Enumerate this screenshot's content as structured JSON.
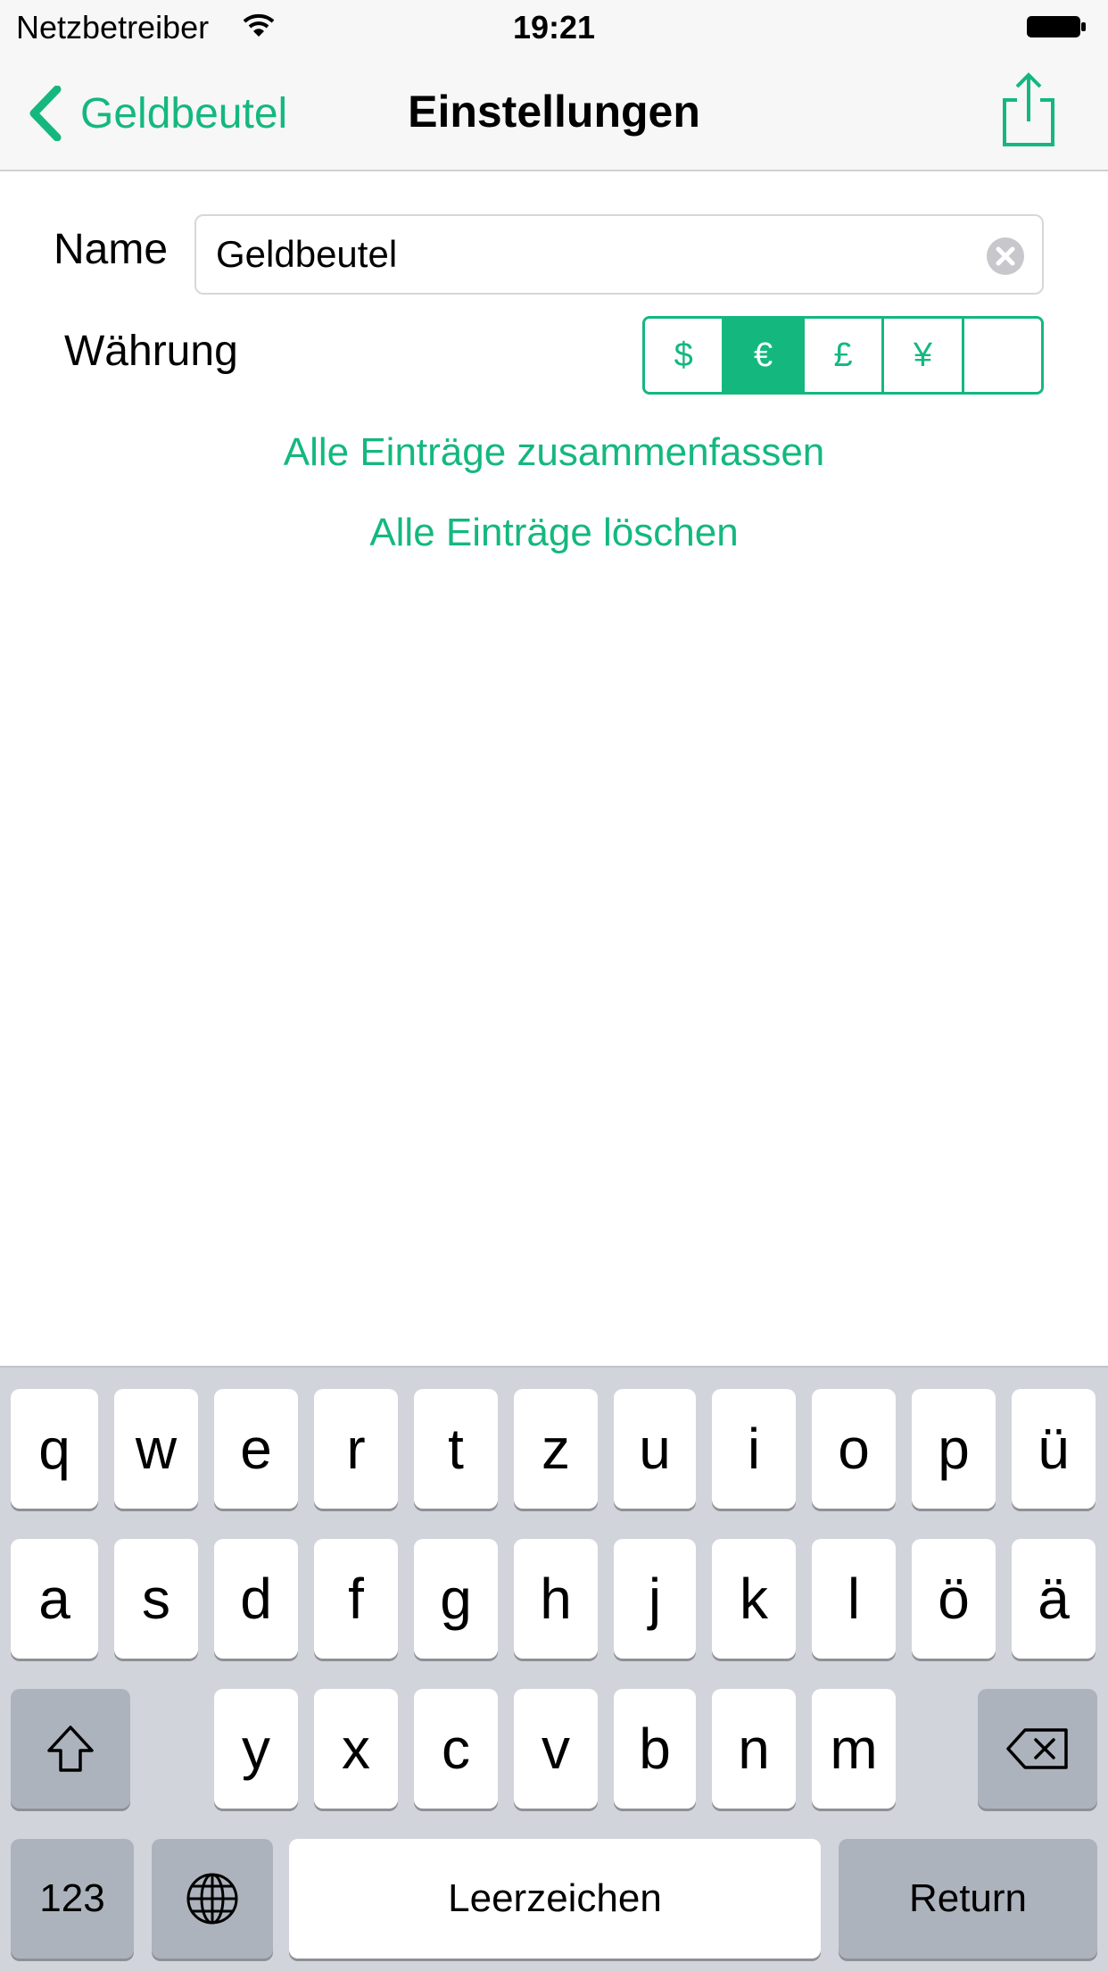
{
  "status_bar": {
    "carrier": "Netzbetreiber",
    "time": "19:21"
  },
  "nav": {
    "back_label": "Geldbeutel",
    "title": "Einstellungen"
  },
  "form": {
    "name_label": "Name",
    "name_value": "Geldbeutel",
    "currency_label": "Währung",
    "currency_options": [
      "$",
      "€",
      "£",
      "¥",
      ""
    ],
    "currency_selected": "€"
  },
  "actions": {
    "merge_all": "Alle Einträge zusammenfassen",
    "delete_all": "Alle Einträge löschen"
  },
  "keyboard": {
    "row1": [
      "q",
      "w",
      "e",
      "r",
      "t",
      "z",
      "u",
      "i",
      "o",
      "p",
      "ü"
    ],
    "row2": [
      "a",
      "s",
      "d",
      "f",
      "g",
      "h",
      "j",
      "k",
      "l",
      "ö",
      "ä"
    ],
    "row3": [
      "y",
      "x",
      "c",
      "v",
      "b",
      "n",
      "m"
    ],
    "numbers_label": "123",
    "space_label": "Leerzeichen",
    "return_label": "Return"
  },
  "colors": {
    "accent": "#14b87f",
    "bar_bg": "#f7f7f7",
    "keyboard_bg": "#d1d4da"
  }
}
